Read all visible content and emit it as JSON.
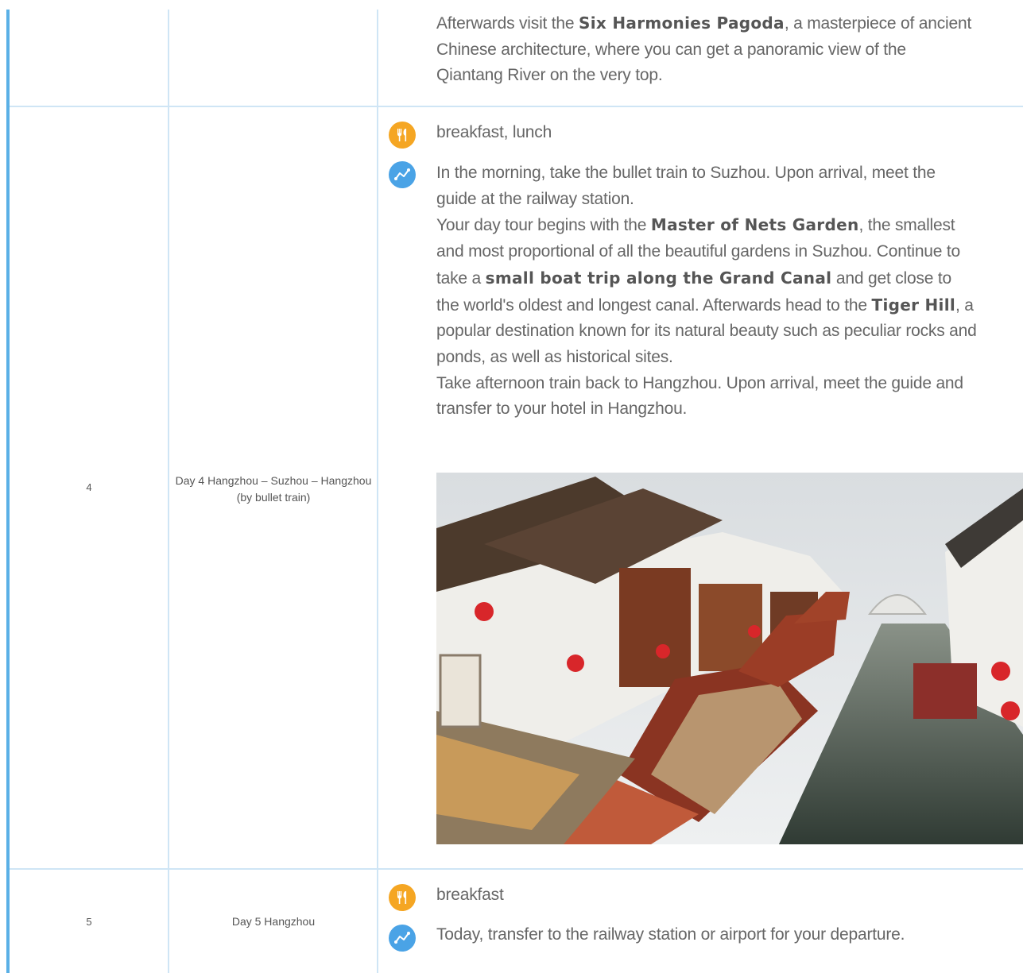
{
  "rows": {
    "row3": {
      "description": {
        "t1": "Afterwards visit the ",
        "b1": "Six Harmonies Pagoda",
        "t2": ", a masterpiece of ancient Chinese architecture, where you can get a panoramic view of the Qiantang River on the very top."
      }
    },
    "row4": {
      "number": "4",
      "day": "Day 4 Hangzhou – Suzhou – Hangzhou (by bullet train)",
      "meals": "breakfast, lunch",
      "description": {
        "p1": "In the morning, take the bullet train to Suzhou. Upon arrival, meet the guide at the railway station.",
        "t1": "Your day tour begins with the ",
        "b1": "Master of Nets Garden",
        "t2": ", the smallest and most proportional of all the beautiful gardens in Suzhou. Continue to take a ",
        "b2": "small boat trip along the Grand Canal",
        "t3": " and get close to the world's oldest and longest canal. Afterwards head to the ",
        "b3": "Tiger Hill",
        "t4": ", a popular destination known for its natural beauty such as peculiar rocks and ponds, as well as historical sites.",
        "p3": "Take afternoon train back to Hangzhou. Upon arrival, meet the guide and transfer to your hotel in Hangzhou."
      }
    },
    "row5": {
      "number": "5",
      "day": "Day 5 Hangzhou",
      "meals": "breakfast",
      "description": "Today, transfer to the railway station or airport for your departure."
    }
  },
  "icons": {
    "meal": "fork-knife-icon",
    "route": "route-icon"
  },
  "colors": {
    "accent": "#5ab0e6",
    "grid": "#cfe5f5",
    "meal_icon": "#f5a623",
    "route_icon": "#4aa3e6"
  }
}
